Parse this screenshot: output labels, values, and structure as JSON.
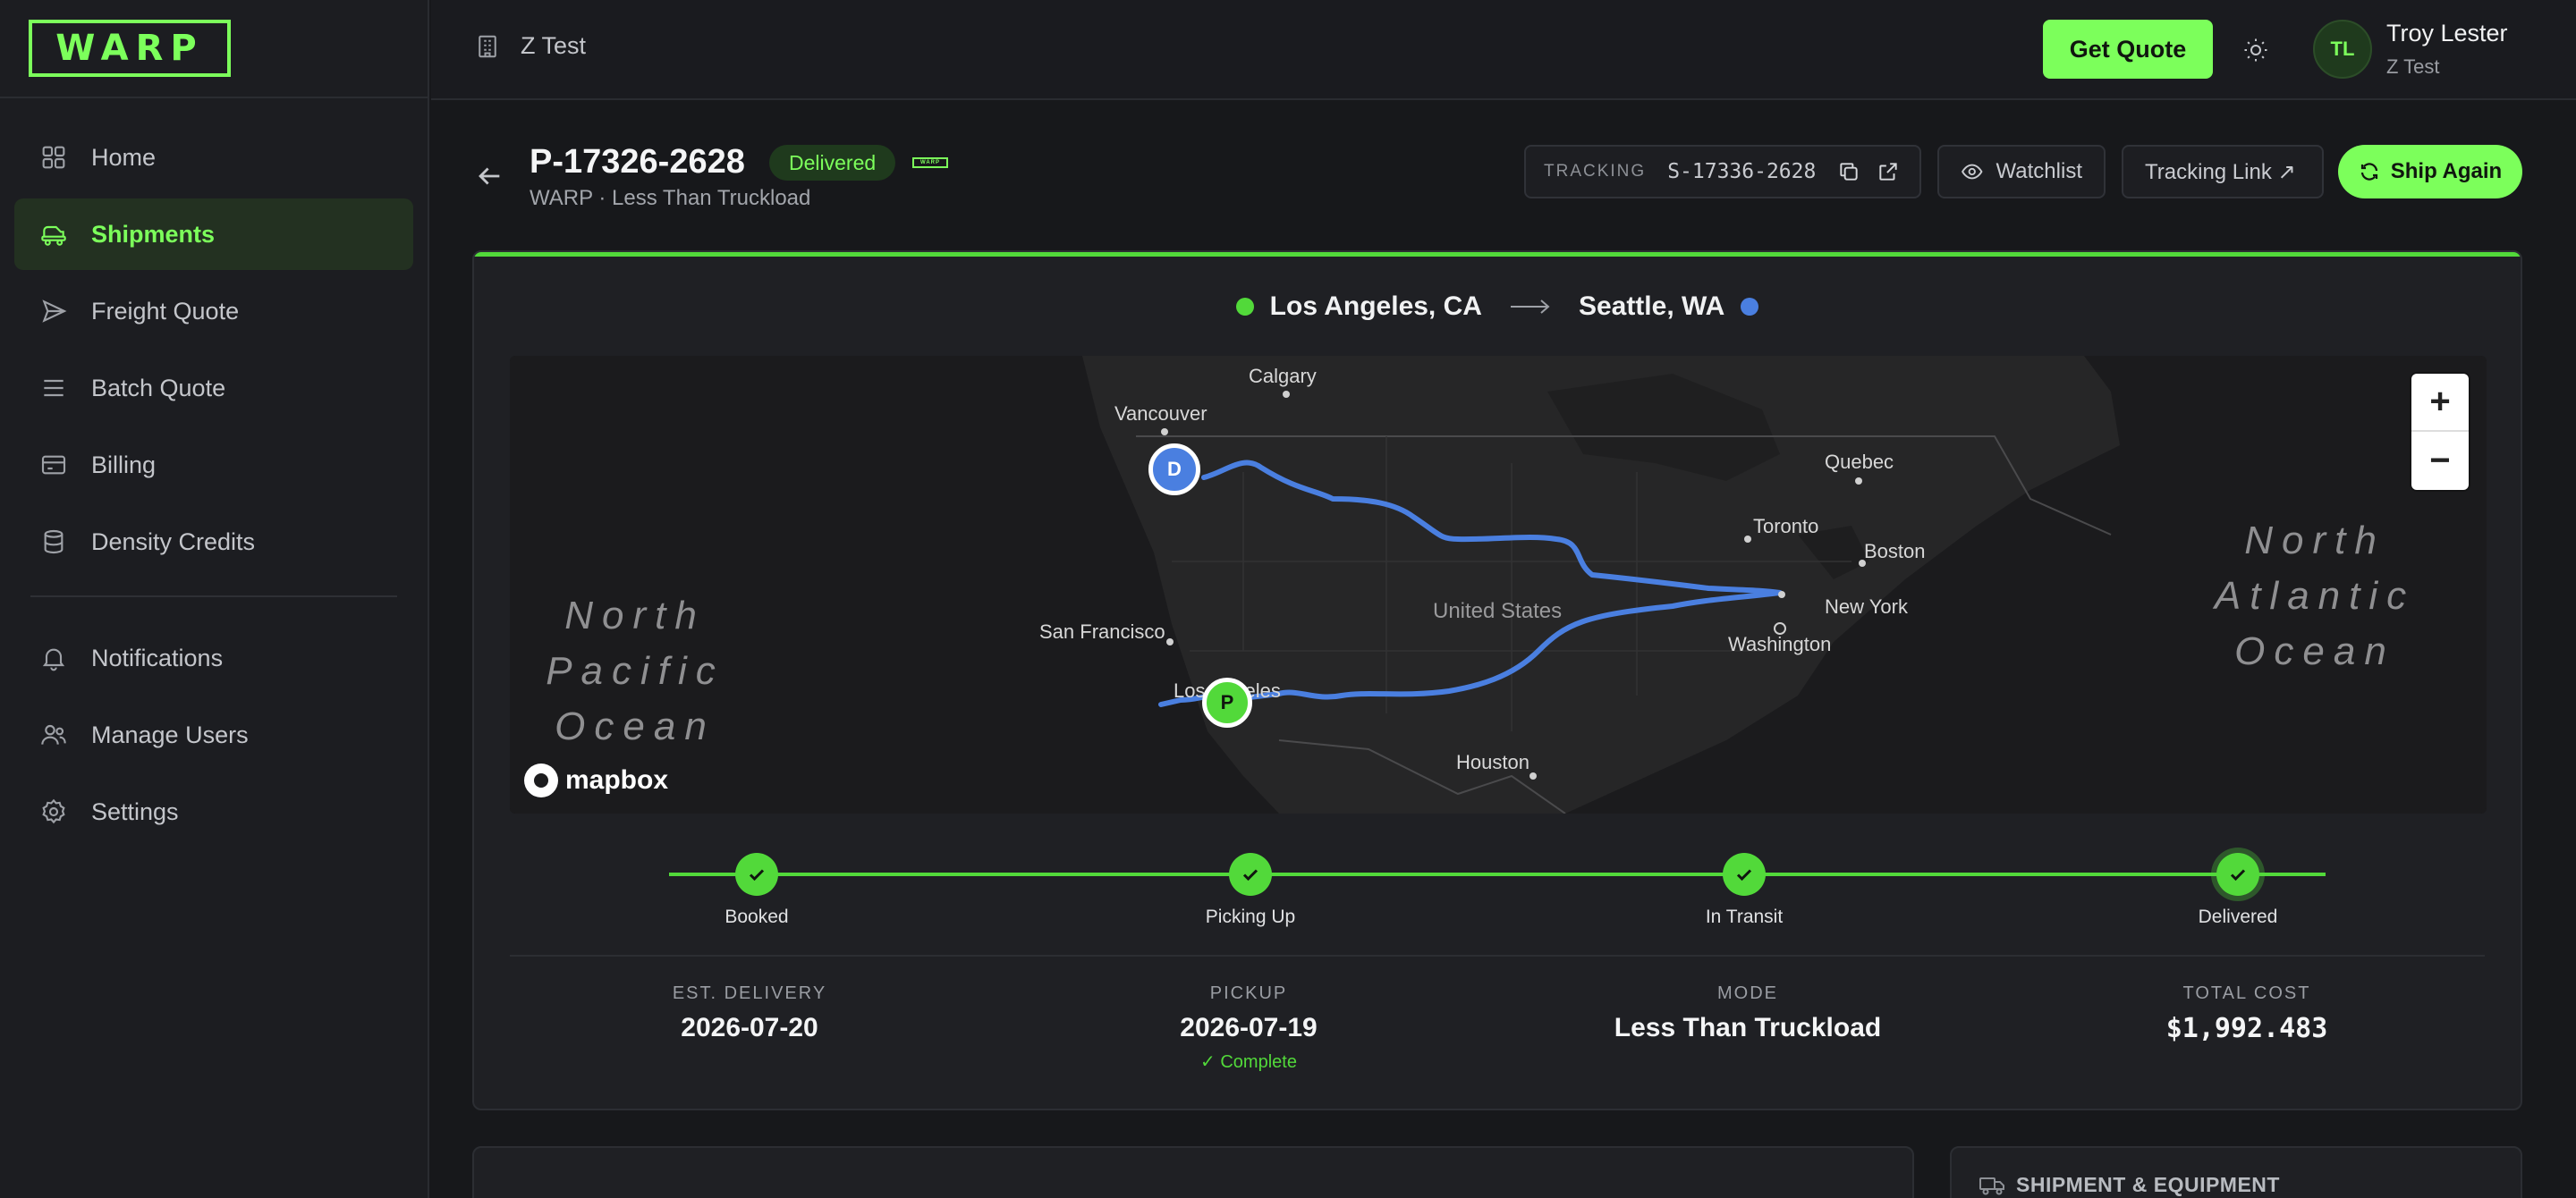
{
  "brand": {
    "logo_text": "WARP",
    "accent": "#7cff5b"
  },
  "sidebar": {
    "items": [
      {
        "label": "Home",
        "icon": "home-grid-icon",
        "active": false
      },
      {
        "label": "Shipments",
        "icon": "truck-icon",
        "active": true
      },
      {
        "label": "Freight Quote",
        "icon": "send-icon",
        "active": false
      },
      {
        "label": "Batch Quote",
        "icon": "list-icon",
        "active": false
      },
      {
        "label": "Billing",
        "icon": "credit-card-icon",
        "active": false
      },
      {
        "label": "Density Credits",
        "icon": "database-icon",
        "active": false
      }
    ],
    "items2": [
      {
        "label": "Notifications",
        "icon": "bell-icon"
      },
      {
        "label": "Manage Users",
        "icon": "users-icon"
      },
      {
        "label": "Settings",
        "icon": "gear-icon"
      }
    ]
  },
  "header": {
    "org_name": "Z Test",
    "get_quote_label": "Get Quote",
    "user": {
      "initials": "TL",
      "name": "Troy Lester",
      "org": "Z Test"
    }
  },
  "shipment": {
    "id": "P-17326-2628",
    "status": "Delivered",
    "subtitle": "WARP · Less Than Truckload",
    "tracking_label": "TRACKING",
    "tracking_number": "S-17336-2628",
    "watchlist_label": "Watchlist",
    "tracking_link_label": "Tracking Link ↗",
    "ship_again_label": "Ship Again",
    "origin": "Los Angeles, CA",
    "destination": "Seattle, WA",
    "origin_color": "#52d93a",
    "destination_color": "#4a7fe0"
  },
  "map": {
    "labels": {
      "calgary": "Calgary",
      "vancouver": "Vancouver",
      "quebec": "Quebec",
      "toronto": "Toronto",
      "boston": "Boston",
      "new_york": "New York",
      "washington": "Washington",
      "united_states": "United States",
      "san_francisco": "San Francisco",
      "los_angeles": "Los Angeles",
      "houston": "Houston",
      "north_pacific_1": "North",
      "north_pacific_2": "Pacific",
      "north_pacific_3": "Ocean",
      "north_atlantic_1": "North",
      "north_atlantic_2": "Atlantic",
      "north_atlantic_3": "Ocean"
    },
    "pickup_marker": "P",
    "delivery_marker": "D",
    "zoom_in": "+",
    "zoom_out": "−",
    "attribution": "mapbox",
    "route_color": "#4a7fe0"
  },
  "progress": {
    "steps": [
      {
        "label": "Booked"
      },
      {
        "label": "Picking Up"
      },
      {
        "label": "In Transit"
      },
      {
        "label": "Delivered"
      }
    ]
  },
  "summary": {
    "est_delivery_label": "EST. DELIVERY",
    "est_delivery": "2026-07-20",
    "pickup_label": "PICKUP",
    "pickup": "2026-07-19",
    "pickup_note": "✓ Complete",
    "mode_label": "MODE",
    "mode": "Less Than Truckload",
    "total_cost_label": "TOTAL COST",
    "total_cost": "$1,992.483"
  },
  "equipment": {
    "title": "SHIPMENT & EQUIPMENT"
  }
}
